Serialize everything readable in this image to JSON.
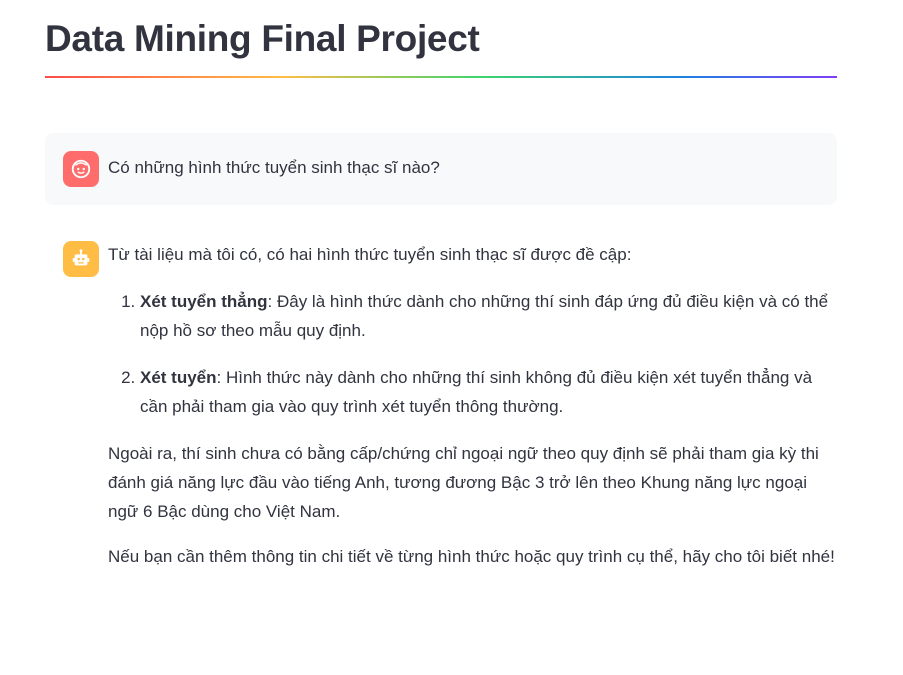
{
  "page": {
    "title": "Data Mining Final Project"
  },
  "chat": {
    "user_message": "Có những hình thức tuyển sinh thạc sĩ nào?",
    "assistant": {
      "intro": "Từ tài liệu mà tôi có, có hai hình thức tuyển sinh thạc sĩ được đề cập:",
      "items": [
        {
          "term": "Xét tuyển thẳng",
          "text": ": Đây là hình thức dành cho những thí sinh đáp ứng đủ điều kiện và có thể nộp hồ sơ theo mẫu quy định."
        },
        {
          "term": "Xét tuyển",
          "text": ": Hình thức này dành cho những thí sinh không đủ điều kiện xét tuyển thẳng và cần phải tham gia vào quy trình xét tuyển thông thường."
        }
      ],
      "paragraph_1": "Ngoài ra, thí sinh chưa có bằng cấp/chứng chỉ ngoại ngữ theo quy định sẽ phải tham gia kỳ thi đánh giá năng lực đầu vào tiếng Anh, tương đương Bậc 3 trở lên theo Khung năng lực ngoại ngữ 6 Bậc dùng cho Việt Nam.",
      "paragraph_2": "Nếu bạn cần thêm thông tin chi tiết về từng hình thức hoặc quy trình cụ thể, hãy cho tôi biết nhé!"
    }
  },
  "icons": {
    "user_avatar": "user-face-icon",
    "assistant_avatar": "robot-icon"
  },
  "colors": {
    "user_avatar_bg": "#ff6c6c",
    "assistant_avatar_bg": "#ffbd45",
    "user_message_bg": "#f8f9fb",
    "text": "#31333f"
  }
}
